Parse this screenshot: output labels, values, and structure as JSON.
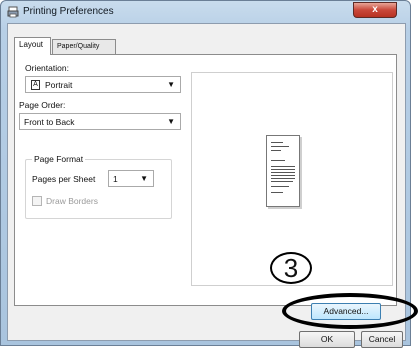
{
  "window": {
    "title": "Printing Preferences",
    "close_glyph": "x"
  },
  "tabs": [
    {
      "label": "Layout",
      "active": true
    },
    {
      "label": "Paper/Quality",
      "active": false
    }
  ],
  "layout": {
    "orientation_label": "Orientation:",
    "orientation_value": "Portrait",
    "page_order_label": "Page Order:",
    "page_order_value": "Front to Back",
    "page_format_title": "Page Format",
    "pages_per_sheet_label": "Pages per Sheet",
    "pages_per_sheet_value": "1",
    "draw_borders_label": "Draw Borders"
  },
  "buttons": {
    "advanced": "Advanced...",
    "ok": "OK",
    "cancel": "Cancel"
  },
  "annotation": {
    "number": "3"
  },
  "colors": {
    "accent": "#bee6fd",
    "close": "#c9483a"
  }
}
